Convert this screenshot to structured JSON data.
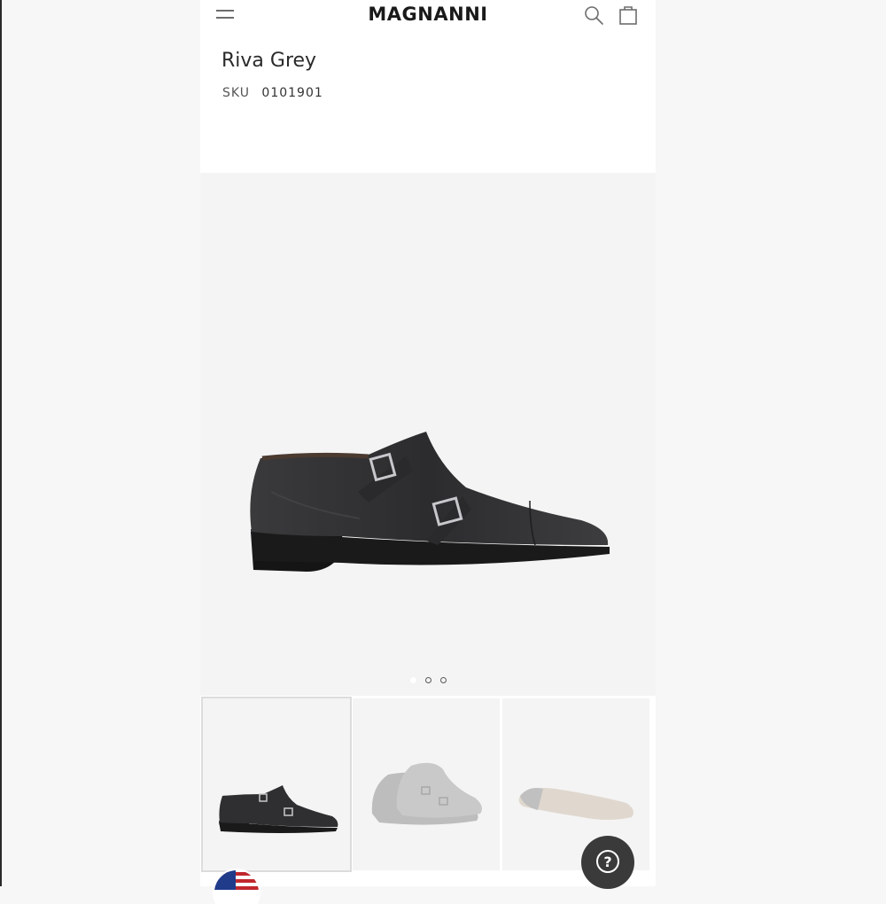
{
  "header": {
    "brand": "MAGNANNI",
    "menu_icon": "hamburger-menu-icon",
    "search_icon": "search-icon",
    "bag_icon": "shopping-bag-icon"
  },
  "product": {
    "name": "Riva Grey",
    "sku_label": "SKU",
    "sku_value": "0101901"
  },
  "gallery": {
    "total_images": 3,
    "active_index": 0,
    "thumbnails": [
      {
        "view": "side-profile",
        "selected": true
      },
      {
        "view": "pair-three-quarter",
        "selected": false
      },
      {
        "view": "sole",
        "selected": false
      }
    ]
  },
  "footer": {
    "flag_icon": "us-flag-icon",
    "help_icon": "question-mark-icon"
  },
  "colors": {
    "page_background": "#f7f7f7",
    "image_background": "#f4f4f4",
    "shoe": "#2e2e30",
    "help_button": "#3a3a3a"
  }
}
